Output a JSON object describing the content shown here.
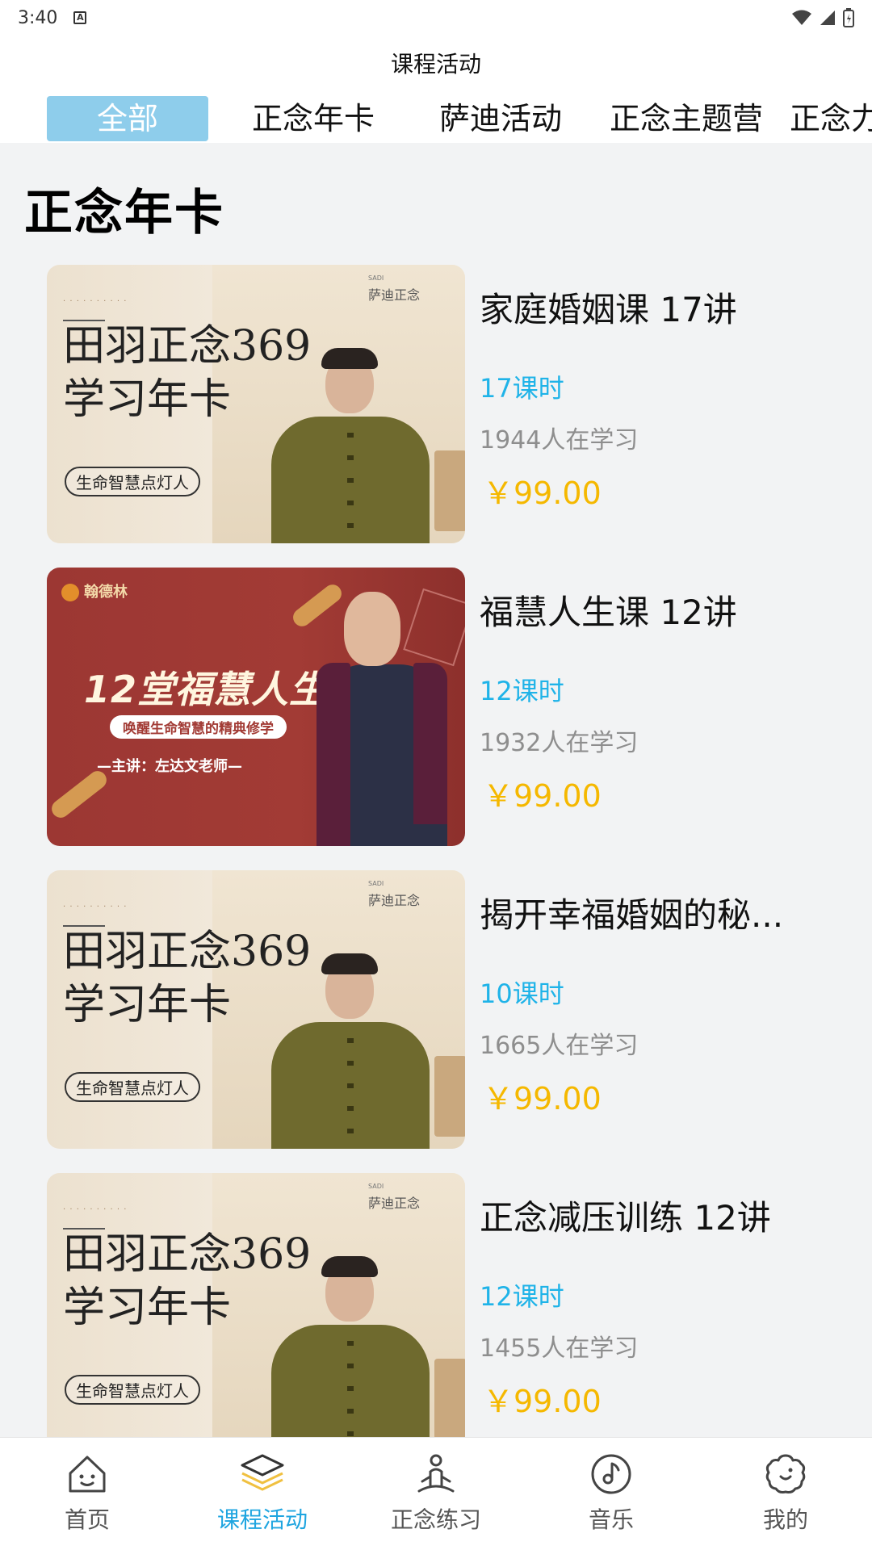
{
  "status_bar": {
    "time": "3:40",
    "indicator": "A"
  },
  "header": {
    "title": "课程活动"
  },
  "tabs": [
    {
      "label": "全部",
      "active": true
    },
    {
      "label": "正念年卡",
      "active": false
    },
    {
      "label": "萨迪活动",
      "active": false
    },
    {
      "label": "正念主题营",
      "active": false
    },
    {
      "label": "正念力",
      "active": false
    }
  ],
  "section": {
    "title": "正念年卡"
  },
  "courses": [
    {
      "name": "家庭婚姻课 17讲",
      "lessons": "17课时",
      "students": "1944人在学习",
      "price": "￥99.00",
      "thumb": {
        "style": "beige",
        "line1": "田羽正念369",
        "line2": "学习年卡",
        "pill": "生命智慧点灯人",
        "brand": "萨迪正念"
      }
    },
    {
      "name": "福慧人生课 12讲",
      "lessons": "12课时",
      "students": "1932人在学习",
      "price": "￥99.00",
      "thumb": {
        "style": "red",
        "logo": "翰德林",
        "title": "12堂福慧人生课",
        "subtitle": "唤醒生命智慧的精典修学",
        "teacher": "—主讲：左达文老师—"
      }
    },
    {
      "name": "揭开幸福婚姻的秘...",
      "lessons": "10课时",
      "students": "1665人在学习",
      "price": "￥99.00",
      "thumb": {
        "style": "beige",
        "line1": "田羽正念369",
        "line2": "学习年卡",
        "pill": "生命智慧点灯人",
        "brand": "萨迪正念"
      }
    },
    {
      "name": "正念减压训练 12讲",
      "lessons": "12课时",
      "students": "1455人在学习",
      "price": "￥99.00",
      "thumb": {
        "style": "beige",
        "line1": "田羽正念369",
        "line2": "学习年卡",
        "pill": "生命智慧点灯人",
        "brand": "萨迪正念"
      }
    }
  ],
  "bottom_nav": [
    {
      "label": "首页",
      "icon": "home-icon",
      "active": false
    },
    {
      "label": "课程活动",
      "icon": "layers-icon",
      "active": true
    },
    {
      "label": "正念练习",
      "icon": "meditation-icon",
      "active": false
    },
    {
      "label": "音乐",
      "icon": "music-disc-icon",
      "active": false
    },
    {
      "label": "我的",
      "icon": "profile-flower-icon",
      "active": false
    }
  ],
  "colors": {
    "accent": "#1fa5e0",
    "tab_active_bg": "#8ecdeb",
    "price": "#f5b800",
    "lessons": "#1fb3e8",
    "students": "#8e8e8e"
  }
}
